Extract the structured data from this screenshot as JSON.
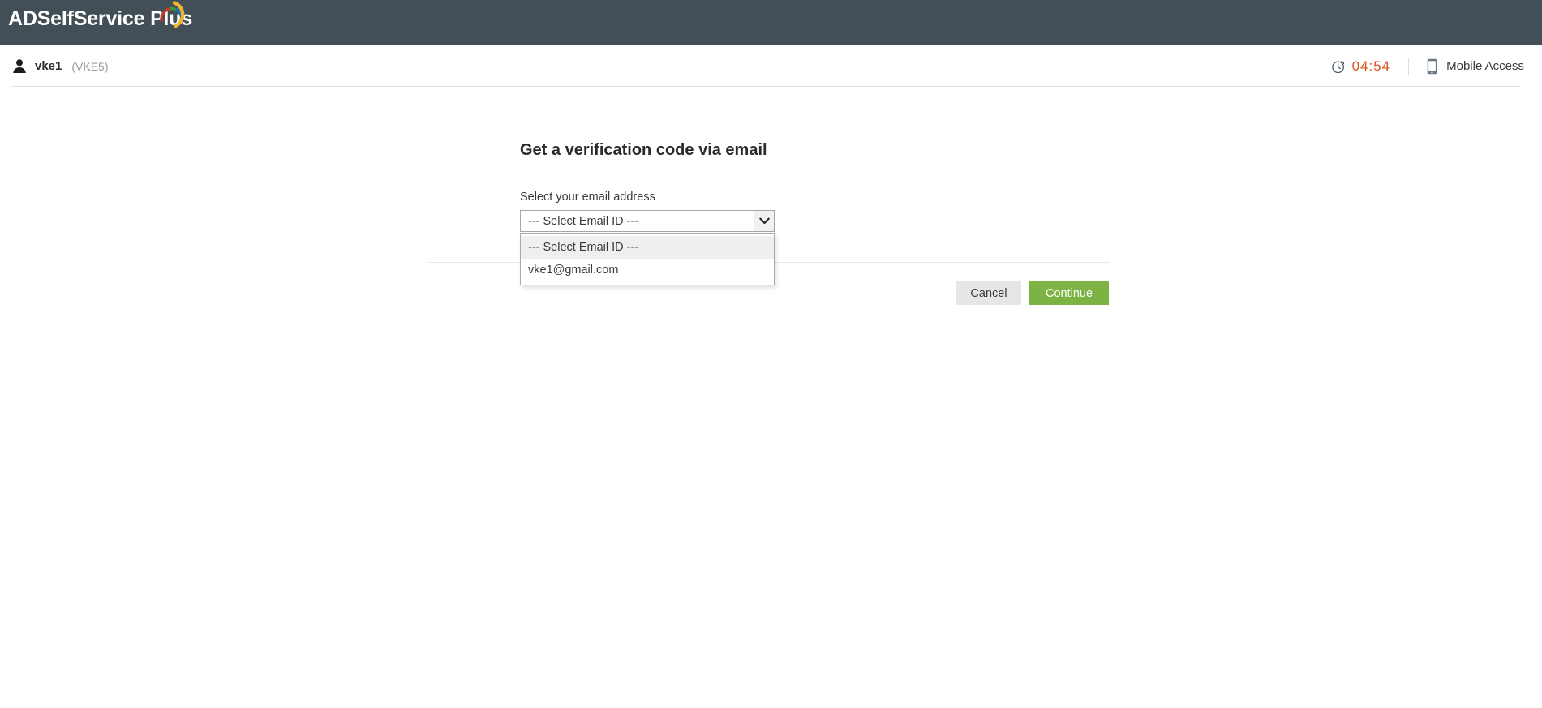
{
  "brand": {
    "product_name": "ADSelfService Plus",
    "logo_icon": "swoosh-icon",
    "bar_color": "#434f57"
  },
  "userbar": {
    "person_icon": "person-icon",
    "user_name": "vke1",
    "user_id": "(VKE5)",
    "timer_icon": "stopwatch-icon",
    "timer_value": "04:54",
    "timer_color": "#d9531e",
    "mobile_icon": "mobile-phone-icon",
    "mobile_label": "Mobile Access"
  },
  "main": {
    "title": "Get a verification code via email",
    "field_label": "Select your email address",
    "select": {
      "icon": "chevron-down-icon",
      "selected_value": "--- Select Email ID ---",
      "expanded": true,
      "options": [
        {
          "label": "--- Select Email ID ---",
          "selected": true
        },
        {
          "label": "vke1@gmail.com",
          "selected": false
        }
      ]
    },
    "actions": {
      "cancel_label": "Cancel",
      "continue_label": "Continue",
      "continue_color": "#7cb342"
    }
  }
}
